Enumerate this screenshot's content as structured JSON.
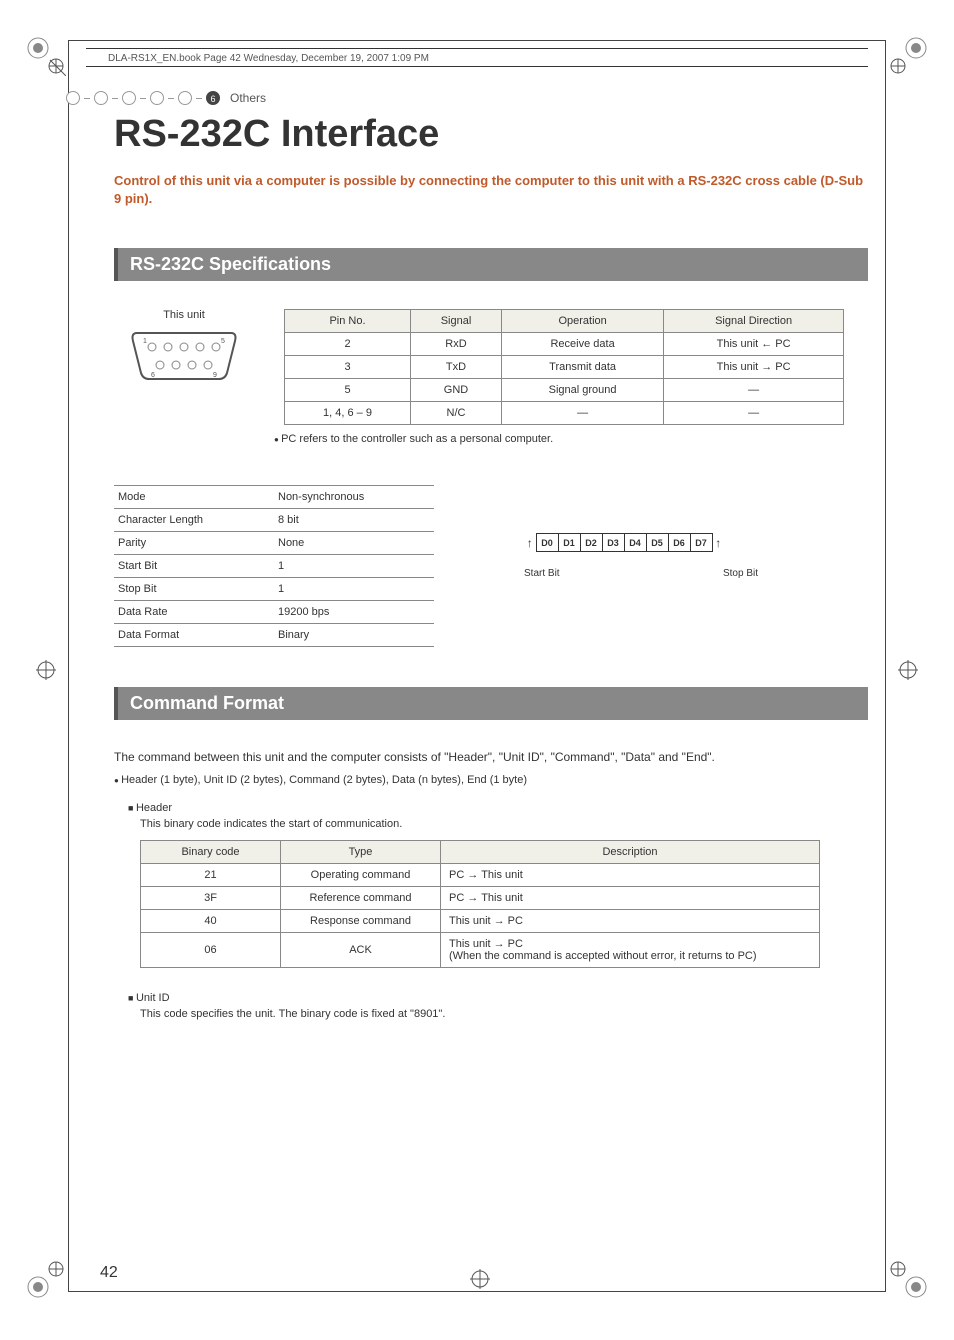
{
  "file_header": "DLA-RS1X_EN.book  Page 42  Wednesday, December 19, 2007  1:09 PM",
  "breadcrumb": {
    "num": "6",
    "label": "Others"
  },
  "title": "RS-232C Interface",
  "intro": "Control of this unit via a computer is possible by connecting the computer to this unit with a RS-232C cross cable (D-Sub 9 pin).",
  "section1": "RS-232C Specifications",
  "port_label": "This unit",
  "pin_headers": [
    "Pin No.",
    "Signal",
    "Operation",
    "Signal Direction"
  ],
  "pin_rows": [
    [
      "2",
      "RxD",
      "Receive data",
      "This unit ← PC"
    ],
    [
      "3",
      "TxD",
      "Transmit data",
      "This unit → PC"
    ],
    [
      "5",
      "GND",
      "Signal ground",
      "—"
    ],
    [
      "1, 4, 6 – 9",
      "N/C",
      "—",
      "—"
    ]
  ],
  "pc_note": "PC refers to the controller such as a personal computer.",
  "mode_rows": [
    [
      "Mode",
      "Non-synchronous"
    ],
    [
      "Character Length",
      "8 bit"
    ],
    [
      "Parity",
      "None"
    ],
    [
      "Start Bit",
      "1"
    ],
    [
      "Stop Bit",
      "1"
    ],
    [
      "Data Rate",
      "19200 bps"
    ],
    [
      "Data Format",
      "Binary"
    ]
  ],
  "frame_bits": [
    "D0",
    "D1",
    "D2",
    "D3",
    "D4",
    "D5",
    "D6",
    "D7"
  ],
  "frame_start": "Start Bit",
  "frame_stop": "Stop Bit",
  "section2": "Command Format",
  "cmd_intro": "The command between this unit and the computer consists of \"Header\", \"Unit ID\", \"Command\", \"Data\" and \"End\".",
  "cmd_bullet": "Header (1 byte), Unit ID (2 bytes), Command (2 bytes), Data (n bytes), End (1 byte)",
  "header_heading": "Header",
  "header_desc": "This binary code indicates the start of communication.",
  "header_th": [
    "Binary code",
    "Type",
    "Description"
  ],
  "header_rows": [
    {
      "code": "21",
      "type": "Operating command",
      "desc": "PC → This unit"
    },
    {
      "code": "3F",
      "type": "Reference command",
      "desc": "PC → This unit"
    },
    {
      "code": "40",
      "type": "Response command",
      "desc": "This unit → PC"
    },
    {
      "code": "06",
      "type": "ACK",
      "desc": "This unit → PC\n(When the command is accepted without error, it returns to PC)"
    }
  ],
  "unitid_heading": "Unit ID",
  "unitid_desc": "This code specifies the unit. The binary code is fixed at \"8901\".",
  "page_num": "42"
}
